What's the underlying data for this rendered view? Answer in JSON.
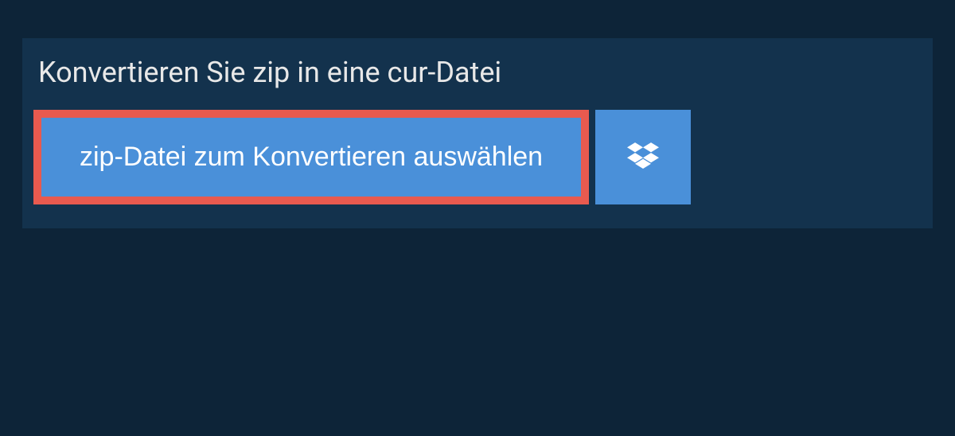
{
  "panel": {
    "heading": "Konvertieren Sie zip in eine cur-Datei",
    "select_button_label": "zip-Datei zum Konvertieren auswählen"
  }
}
